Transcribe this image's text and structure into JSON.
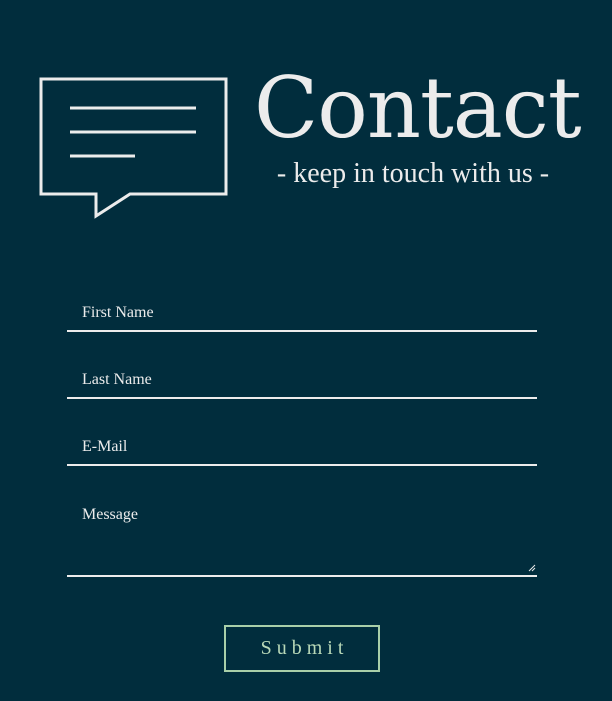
{
  "header": {
    "icon": "chat-bubble-icon",
    "title": "Contact",
    "subtitle": "- keep in touch with us -"
  },
  "form": {
    "first_name": {
      "placeholder": "First Name",
      "value": ""
    },
    "last_name": {
      "placeholder": "Last Name",
      "value": ""
    },
    "email": {
      "placeholder": "E-Mail",
      "value": ""
    },
    "message": {
      "placeholder": "Message",
      "value": ""
    },
    "submit_label": "Submit"
  },
  "colors": {
    "background": "#012d3d",
    "text": "#ececec",
    "button_accent": "#a9cfa9"
  }
}
